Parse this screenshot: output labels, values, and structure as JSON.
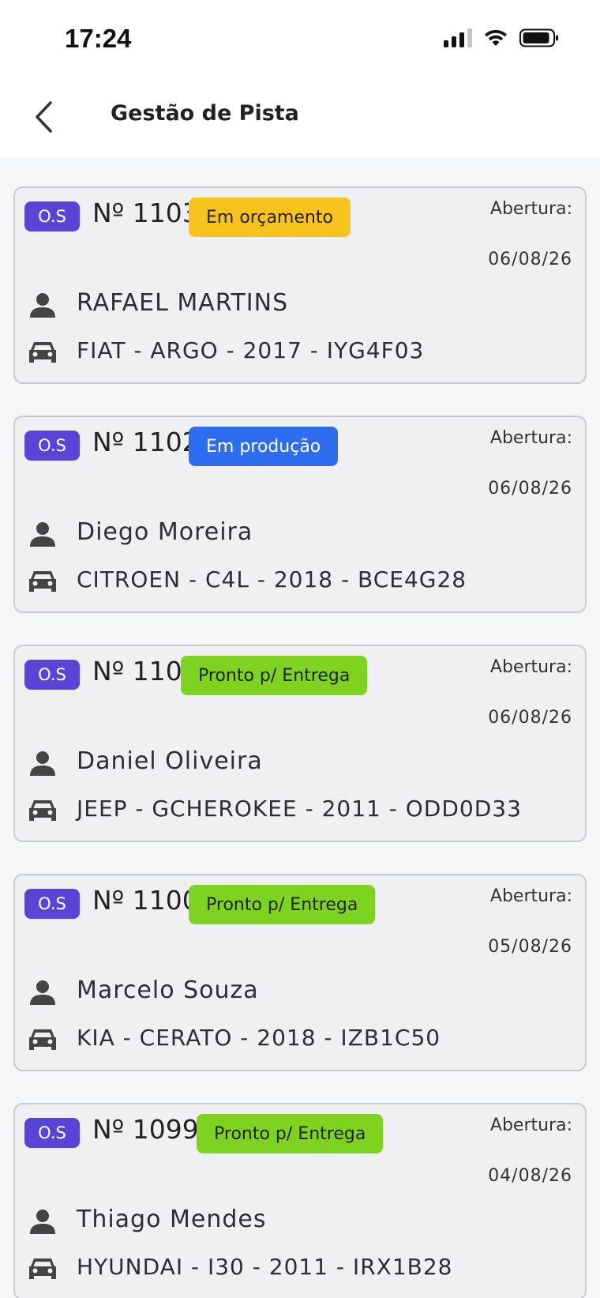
{
  "status_bar": {
    "time": "17:24",
    "icons": [
      "cellular-signal-icon",
      "wifi-icon",
      "battery-icon"
    ]
  },
  "header": {
    "title": "Gestão de Pista",
    "back_icon": "chevron-left-icon"
  },
  "colors": {
    "os_badge": "#5a44d8",
    "status_orcamento": "#f7c31c",
    "status_producao": "#2f6df0",
    "status_pronto": "#7ed321"
  },
  "orders": [
    {
      "badge": "O.S",
      "number": "Nº 1103",
      "status": "Em orçamento",
      "status_color": "#f7c31c",
      "status_text_color": "#222222",
      "open_label": "Abertura:",
      "open_date": "06/08/26",
      "customer": "RAFAEL MARTINS",
      "vehicle": "FIAT - ARGO - 2017 - IYG4F03"
    },
    {
      "badge": "O.S",
      "number": "Nº 1102",
      "status": "Em produção",
      "status_color": "#2f6df0",
      "status_text_color": "#ffffff",
      "open_label": "Abertura:",
      "open_date": "06/08/26",
      "customer": "Diego Moreira",
      "vehicle": "CITROEN - C4L - 2018 - BCE4G28"
    },
    {
      "badge": "O.S",
      "number": "Nº 1101",
      "status": "Pronto p/ Entrega",
      "status_color": "#7ed321",
      "status_text_color": "#222222",
      "open_label": "Abertura:",
      "open_date": "06/08/26",
      "customer": "Daniel Oliveira",
      "vehicle": "JEEP - GCHEROKEE - 2011 - ODD0D33"
    },
    {
      "badge": "O.S",
      "number": "Nº 1100",
      "status": "Pronto p/ Entrega",
      "status_color": "#7ed321",
      "status_text_color": "#222222",
      "open_label": "Abertura:",
      "open_date": "05/08/26",
      "customer": "Marcelo Souza",
      "vehicle": "KIA - CERATO - 2018 - IZB1C50"
    },
    {
      "badge": "O.S",
      "number": "Nº 1099",
      "status": "Pronto p/ Entrega",
      "status_color": "#7ed321",
      "status_text_color": "#222222",
      "open_label": "Abertura:",
      "open_date": "04/08/26",
      "customer": "Thiago Mendes",
      "vehicle": "HYUNDAI - I30 - 2011 - IRX1B28"
    }
  ]
}
